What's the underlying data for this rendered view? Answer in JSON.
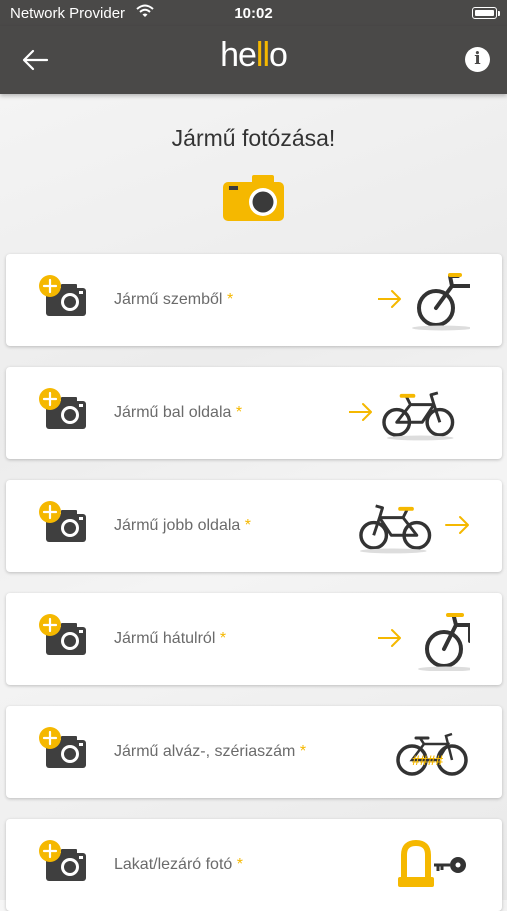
{
  "status_bar": {
    "carrier": "Network Provider",
    "time": "10:02"
  },
  "nav": {
    "logo_he": "he",
    "logo_ll": "ll",
    "logo_o": "o",
    "back_icon": "arrow-left-icon",
    "info_icon": "info-icon"
  },
  "title": "Jármű fotózása!",
  "accent_color": "#f5b800",
  "bar_color": "#4a4948",
  "items": [
    {
      "label": "Jármű szemből",
      "required": "*",
      "image": "bike-front-view"
    },
    {
      "label": "Jármű bal oldala",
      "required": "*",
      "image": "bike-left-side"
    },
    {
      "label": "Jármű jobb oldala",
      "required": "*",
      "image": "bike-right-side"
    },
    {
      "label": "Jármű hátulról",
      "required": "*",
      "image": "bike-rear-view"
    },
    {
      "label": "Jármű alváz-, szériaszám",
      "required": "*",
      "image": "bike-frame-serial"
    },
    {
      "label": "Lakat/lezáró fotó",
      "required": "*",
      "image": "lock-and-key"
    }
  ]
}
